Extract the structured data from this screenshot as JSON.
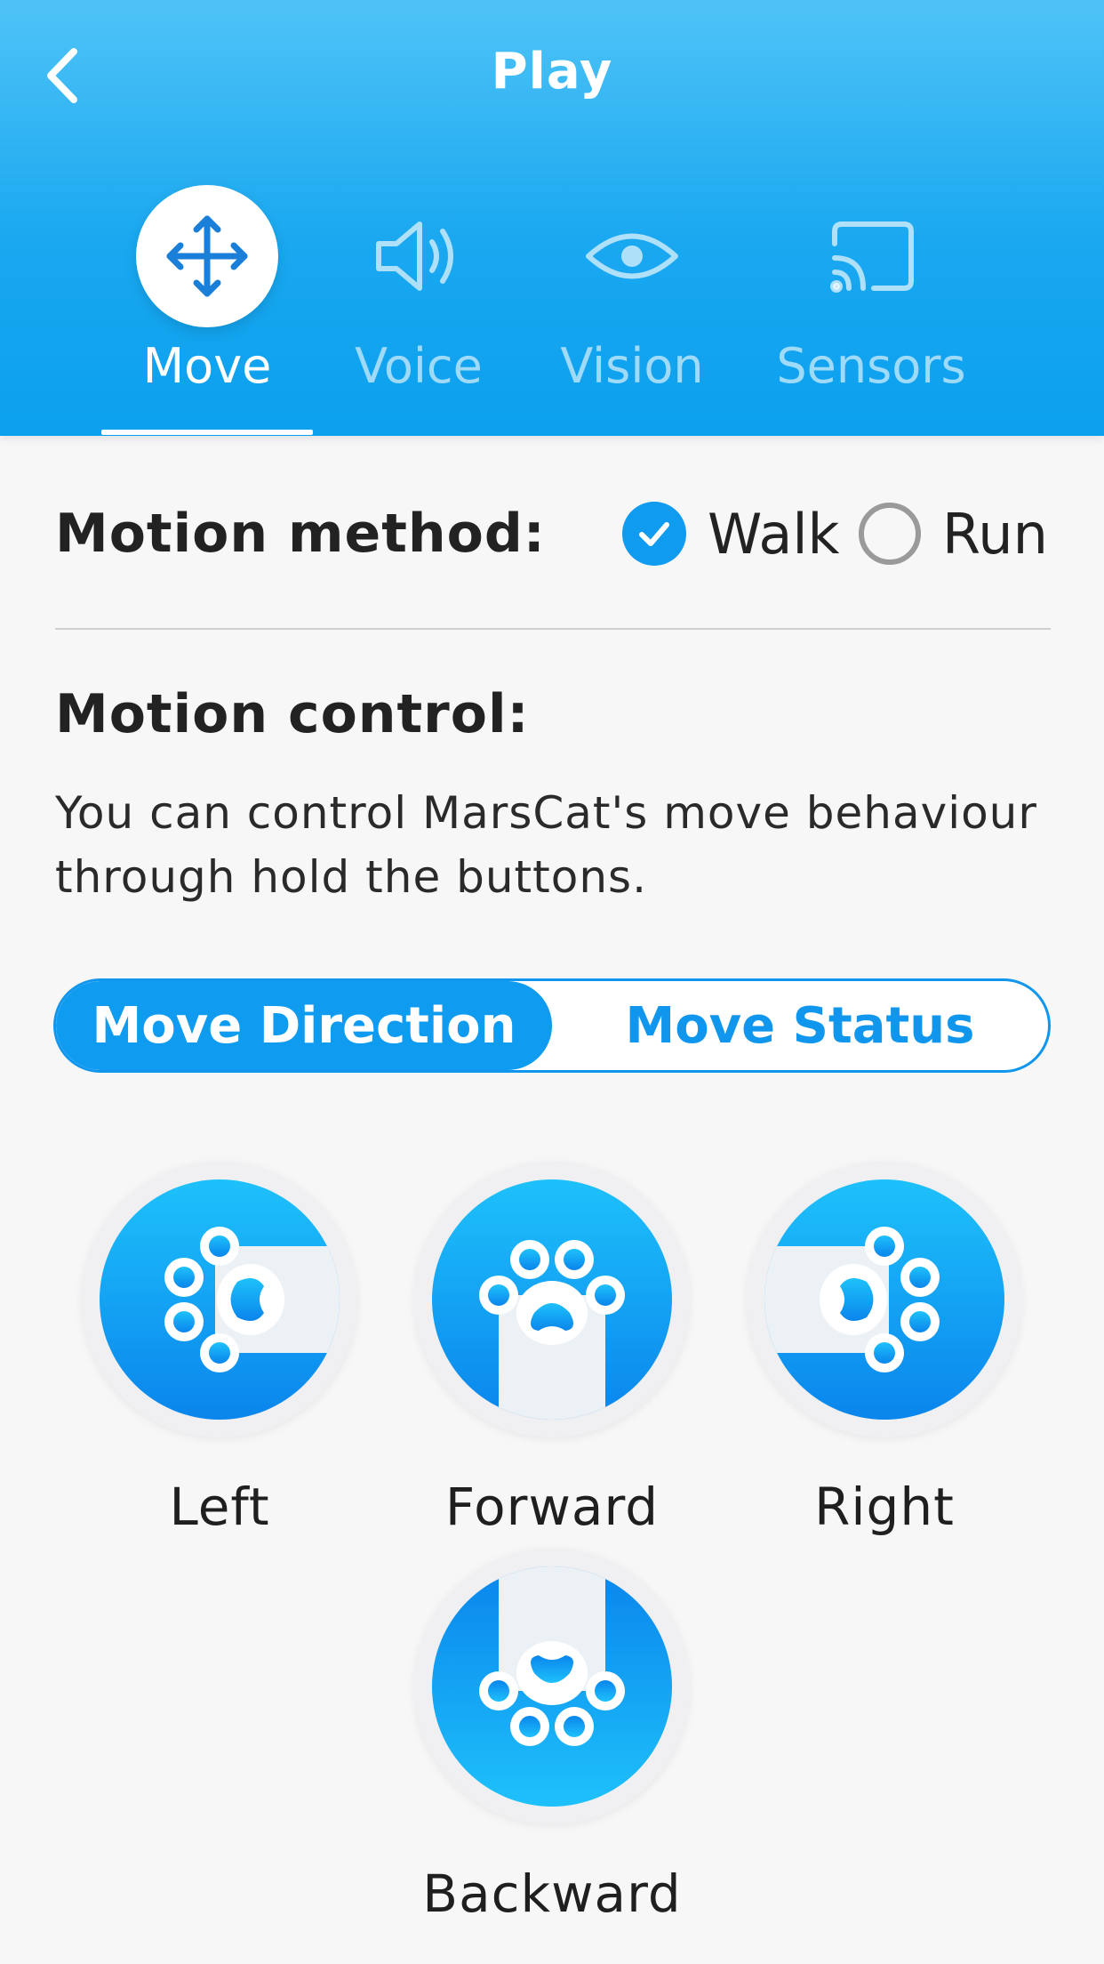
{
  "header": {
    "title": "Play",
    "tabs": [
      {
        "label": "Move",
        "icon": "move-arrows-icon",
        "active": true
      },
      {
        "label": "Voice",
        "icon": "speaker-icon",
        "active": false
      },
      {
        "label": "Vision",
        "icon": "eye-icon",
        "active": false
      },
      {
        "label": "Sensors",
        "icon": "cast-icon",
        "active": false
      }
    ]
  },
  "motion_method": {
    "title": "Motion method:",
    "options": [
      {
        "label": "Walk",
        "selected": true
      },
      {
        "label": "Run",
        "selected": false
      }
    ]
  },
  "motion_control": {
    "title": "Motion control:",
    "description": "You can control MarsCat's move behaviour through hold the buttons.",
    "segments": [
      {
        "label": "Move Direction",
        "active": true
      },
      {
        "label": "Move Status",
        "active": false
      }
    ],
    "buttons": [
      {
        "label": "Left",
        "icon": "paw-left-icon"
      },
      {
        "label": "Forward",
        "icon": "paw-forward-icon"
      },
      {
        "label": "Right",
        "icon": "paw-right-icon"
      },
      {
        "label": "Backward",
        "icon": "paw-backward-icon"
      }
    ]
  },
  "colors": {
    "accent": "#0e9bf0",
    "header_top": "#4fc3f7",
    "header_bottom": "#0ba0ee",
    "background": "#f7f7f8"
  }
}
